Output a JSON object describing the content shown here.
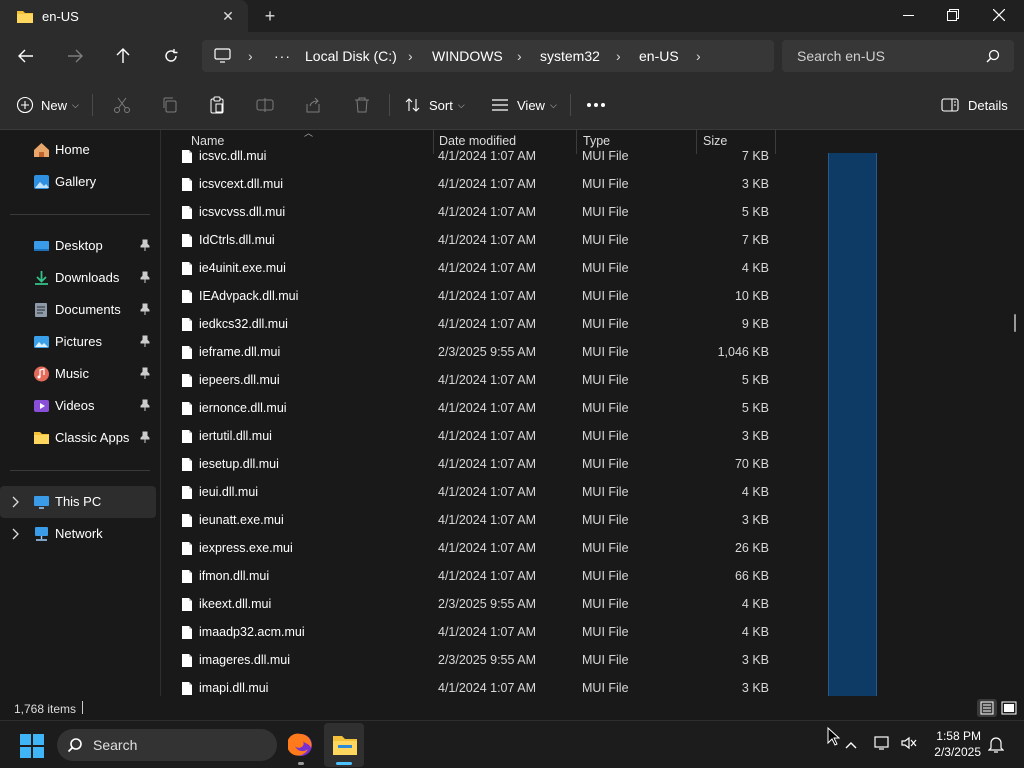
{
  "window": {
    "tab_title": "en-US"
  },
  "breadcrumbs": [
    "Local Disk (C:)",
    "WINDOWS",
    "system32",
    "en-US"
  ],
  "search": {
    "placeholder": "Search en-US"
  },
  "toolbar": {
    "new_label": "New",
    "sort_label": "Sort",
    "view_label": "View",
    "details_label": "Details"
  },
  "sidebar": {
    "items": [
      {
        "label": "Home",
        "icon": "home-icon"
      },
      {
        "label": "Gallery",
        "icon": "gallery-icon"
      },
      {
        "label": "Desktop",
        "icon": "desktop-icon",
        "pinned": true
      },
      {
        "label": "Downloads",
        "icon": "downloads-icon",
        "pinned": true
      },
      {
        "label": "Documents",
        "icon": "documents-icon",
        "pinned": true
      },
      {
        "label": "Pictures",
        "icon": "pictures-icon",
        "pinned": true
      },
      {
        "label": "Music",
        "icon": "music-icon",
        "pinned": true
      },
      {
        "label": "Videos",
        "icon": "videos-icon",
        "pinned": true
      },
      {
        "label": "Classic Apps",
        "icon": "folder-icon",
        "pinned": true
      },
      {
        "label": "This PC",
        "icon": "pc-icon",
        "selected": true
      },
      {
        "label": "Network",
        "icon": "network-icon"
      }
    ]
  },
  "columns": {
    "name": "Name",
    "date": "Date modified",
    "type": "Type",
    "size": "Size"
  },
  "files": [
    {
      "name": "icsvc.dll.mui",
      "date": "4/1/2024 1:07 AM",
      "type": "MUI File",
      "size": "7 KB"
    },
    {
      "name": "icsvcext.dll.mui",
      "date": "4/1/2024 1:07 AM",
      "type": "MUI File",
      "size": "3 KB"
    },
    {
      "name": "icsvcvss.dll.mui",
      "date": "4/1/2024 1:07 AM",
      "type": "MUI File",
      "size": "5 KB"
    },
    {
      "name": "IdCtrls.dll.mui",
      "date": "4/1/2024 1:07 AM",
      "type": "MUI File",
      "size": "7 KB"
    },
    {
      "name": "ie4uinit.exe.mui",
      "date": "4/1/2024 1:07 AM",
      "type": "MUI File",
      "size": "4 KB"
    },
    {
      "name": "IEAdvpack.dll.mui",
      "date": "4/1/2024 1:07 AM",
      "type": "MUI File",
      "size": "10 KB"
    },
    {
      "name": "iedkcs32.dll.mui",
      "date": "4/1/2024 1:07 AM",
      "type": "MUI File",
      "size": "9 KB"
    },
    {
      "name": "ieframe.dll.mui",
      "date": "2/3/2025 9:55 AM",
      "type": "MUI File",
      "size": "1,046 KB"
    },
    {
      "name": "iepeers.dll.mui",
      "date": "4/1/2024 1:07 AM",
      "type": "MUI File",
      "size": "5 KB"
    },
    {
      "name": "iernonce.dll.mui",
      "date": "4/1/2024 1:07 AM",
      "type": "MUI File",
      "size": "5 KB"
    },
    {
      "name": "iertutil.dll.mui",
      "date": "4/1/2024 1:07 AM",
      "type": "MUI File",
      "size": "3 KB"
    },
    {
      "name": "iesetup.dll.mui",
      "date": "4/1/2024 1:07 AM",
      "type": "MUI File",
      "size": "70 KB"
    },
    {
      "name": "ieui.dll.mui",
      "date": "4/1/2024 1:07 AM",
      "type": "MUI File",
      "size": "4 KB"
    },
    {
      "name": "ieunatt.exe.mui",
      "date": "4/1/2024 1:07 AM",
      "type": "MUI File",
      "size": "3 KB"
    },
    {
      "name": "iexpress.exe.mui",
      "date": "4/1/2024 1:07 AM",
      "type": "MUI File",
      "size": "26 KB"
    },
    {
      "name": "ifmon.dll.mui",
      "date": "4/1/2024 1:07 AM",
      "type": "MUI File",
      "size": "66 KB"
    },
    {
      "name": "ikeext.dll.mui",
      "date": "2/3/2025 9:55 AM",
      "type": "MUI File",
      "size": "4 KB"
    },
    {
      "name": "imaadp32.acm.mui",
      "date": "4/1/2024 1:07 AM",
      "type": "MUI File",
      "size": "4 KB"
    },
    {
      "name": "imageres.dll.mui",
      "date": "2/3/2025 9:55 AM",
      "type": "MUI File",
      "size": "3 KB"
    },
    {
      "name": "imapi.dll.mui",
      "date": "4/1/2024 1:07 AM",
      "type": "MUI File",
      "size": "3 KB"
    }
  ],
  "status": {
    "item_count": "1,768 items"
  },
  "taskbar": {
    "search_label": "Search",
    "time": "1:58 PM",
    "date": "2/3/2025"
  },
  "colors": {
    "accent": "#4cc2ff",
    "preview_pane": "#0e3a66"
  }
}
